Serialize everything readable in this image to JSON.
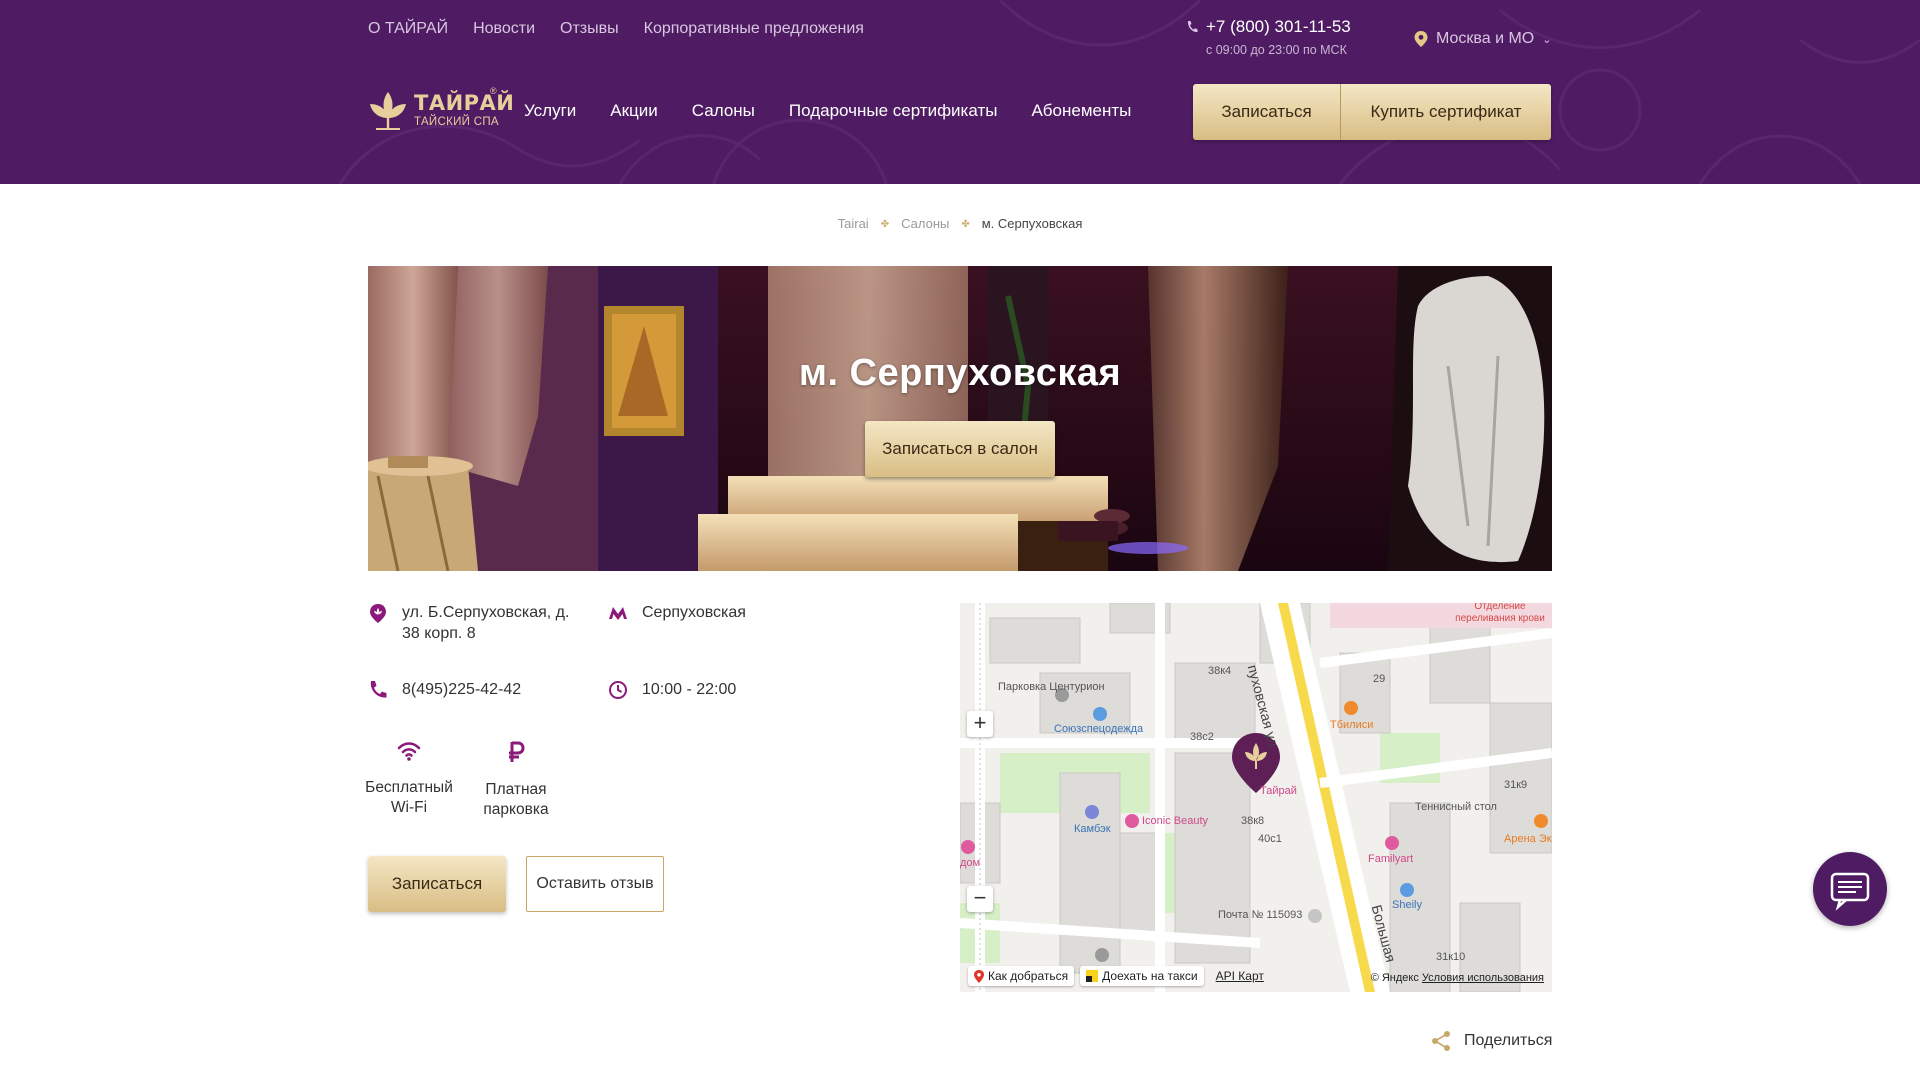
{
  "header": {
    "top_links": [
      "О ТАЙРАЙ",
      "Новости",
      "Отзывы",
      "Корпоративные предложения"
    ],
    "phone": "+7 (800) 301-11-53",
    "hours": "с 09:00 до 23:00 по МСК",
    "city": "Москва и МО",
    "logo_title": "ТАЙРАЙ",
    "logo_subtitle": "ТАЙСКИЙ СПА",
    "logo_reg": "®",
    "nav": [
      "Услуги",
      "Акции",
      "Салоны",
      "Подарочные сертификаты",
      "Абонементы"
    ],
    "book_label": "Записаться",
    "cert_label": "Купить сертификат"
  },
  "breadcrumb": {
    "home": "Tairai",
    "section": "Салоны",
    "current": "м. Серпуховская",
    "separator": "✤"
  },
  "hero": {
    "title": "м. Серпуховская",
    "button": "Записаться в салон"
  },
  "info": {
    "address": "ул. Б.Серпуховская, д. 38 корп. 8",
    "metro": "Серпуховская",
    "phone": "8(495)225-42-42",
    "hours": "10:00 - 22:00"
  },
  "amenities": [
    {
      "label": "Бесплатный Wi-Fi",
      "icon": "wifi-icon"
    },
    {
      "label": "Платная парковка",
      "icon": "ruble-icon"
    }
  ],
  "actions": {
    "book": "Записаться",
    "review": "Оставить отзыв"
  },
  "map": {
    "labels": {
      "parking": "Парковка Центурион",
      "souz": "Союзспецодежда",
      "b38k4": "38к4",
      "b38c2": "38с2",
      "street": "пуховская ул.",
      "street2": "Большая",
      "b29": "29",
      "tbilisi": "Тбилиси",
      "hospital": "Отделение переливания крови",
      "tairai": "Тайрай",
      "iconic": "Iconic Beauty",
      "kambek": "Камбэк",
      "b38k8": "38к8",
      "b40c1": "40с1",
      "familyart": "Familyart",
      "sheily": "Sheily",
      "post": "Почта № 115093",
      "tennis": "Теннисный стол",
      "b31k9": "31к9",
      "arena": "Арена Эк",
      "b31k10": "31к10",
      "dom": "дом"
    },
    "zoom_in": "+",
    "zoom_out": "−",
    "route": "Как добраться",
    "taxi": "Доехать на такси",
    "api": "API Карт",
    "copyright": "© Яндекс",
    "terms": "Условия использования"
  },
  "share_label": "Поделиться",
  "colors": {
    "brand_purple": "#4f1c63",
    "gold": "#d8bd84",
    "icon_purple": "#8b1a7a"
  }
}
